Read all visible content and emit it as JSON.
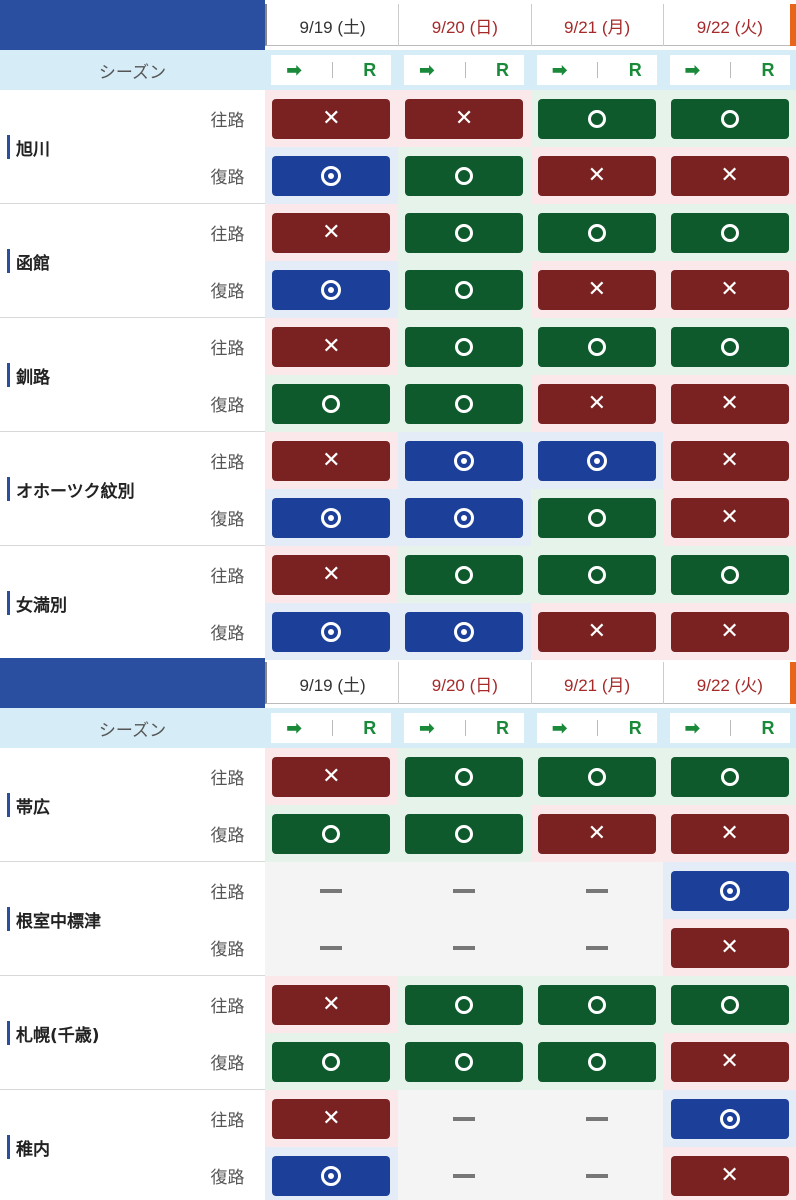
{
  "dates": [
    {
      "label": "9/19 (土)",
      "color": "dark"
    },
    {
      "label": "9/20 (日)",
      "color": "red"
    },
    {
      "label": "9/21 (月)",
      "color": "red"
    },
    {
      "label": "9/22 (火)",
      "color": "red"
    }
  ],
  "season_label": "シーズン",
  "season_arrow": "➡",
  "season_r": "R",
  "outbound_label": "往路",
  "return_label": "復路",
  "symbols": {
    "x": "✕",
    "circle": "○",
    "double_circle": "◎",
    "none": "—"
  },
  "colors": {
    "red": "#7a2222",
    "green": "#0e5a2c",
    "blue": "#1c3f99",
    "accent": "#2b4fa0"
  },
  "sections": [
    {
      "cities": [
        {
          "name": "旭川",
          "outbound": [
            "x",
            "x",
            "circle",
            "circle"
          ],
          "return": [
            "double_circle",
            "circle",
            "x",
            "x"
          ]
        },
        {
          "name": "函館",
          "outbound": [
            "x",
            "circle",
            "circle",
            "circle"
          ],
          "return": [
            "double_circle",
            "circle",
            "x",
            "x"
          ]
        },
        {
          "name": "釧路",
          "outbound": [
            "x",
            "circle",
            "circle",
            "circle"
          ],
          "return": [
            "circle",
            "circle",
            "x",
            "x"
          ]
        },
        {
          "name": "オホーツク紋別",
          "outbound": [
            "x",
            "double_circle",
            "double_circle",
            "x"
          ],
          "return": [
            "double_circle",
            "double_circle",
            "circle",
            "x"
          ]
        },
        {
          "name": "女満別",
          "outbound": [
            "x",
            "circle",
            "circle",
            "circle"
          ],
          "return": [
            "double_circle",
            "double_circle",
            "x",
            "x"
          ]
        }
      ]
    },
    {
      "cities": [
        {
          "name": "帯広",
          "outbound": [
            "x",
            "circle",
            "circle",
            "circle"
          ],
          "return": [
            "circle",
            "circle",
            "x",
            "x"
          ]
        },
        {
          "name": "根室中標津",
          "outbound": [
            "none",
            "none",
            "none",
            "double_circle"
          ],
          "return": [
            "none",
            "none",
            "none",
            "x"
          ]
        },
        {
          "name": "札幌(千歳)",
          "outbound": [
            "x",
            "circle",
            "circle",
            "circle"
          ],
          "return": [
            "circle",
            "circle",
            "circle",
            "x"
          ]
        },
        {
          "name": "稚内",
          "outbound": [
            "x",
            "none",
            "none",
            "double_circle"
          ],
          "return": [
            "double_circle",
            "none",
            "none",
            "x"
          ]
        }
      ]
    }
  ]
}
